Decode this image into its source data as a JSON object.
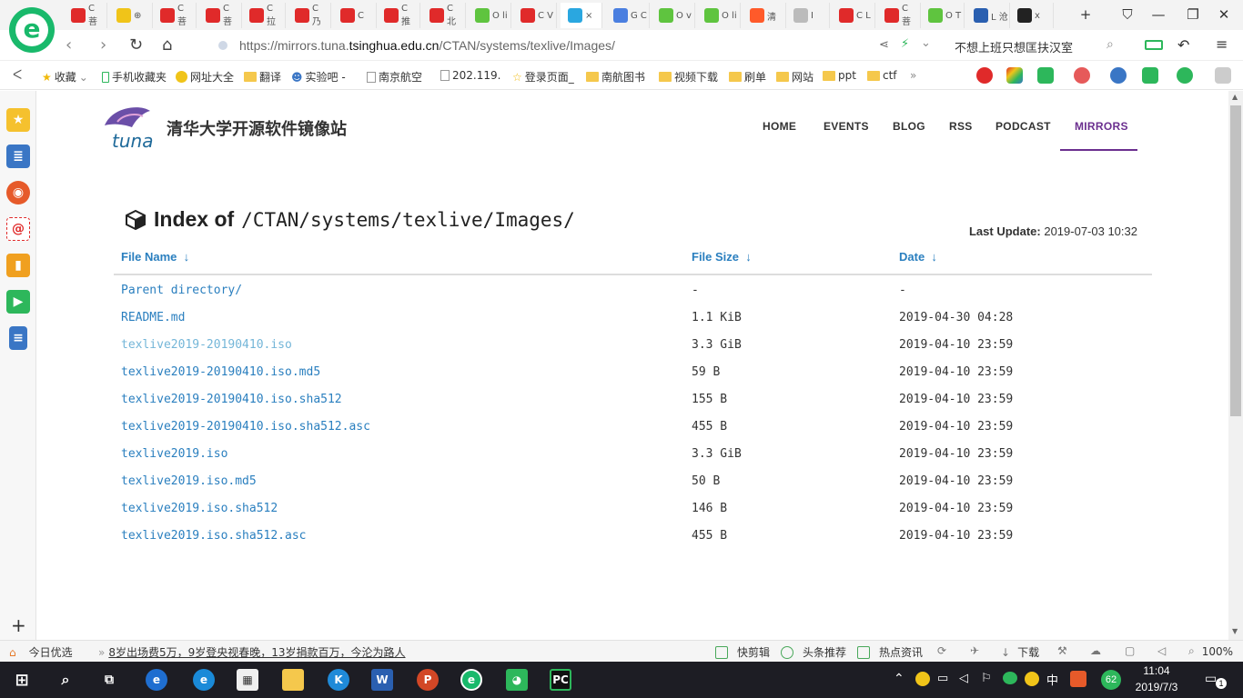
{
  "browser": {
    "tabs": [
      {
        "label": "C 菩",
        "color": "#e02a2a"
      },
      {
        "label": "⊕",
        "color": "#f0c419"
      },
      {
        "label": "C 菩",
        "color": "#e02a2a"
      },
      {
        "label": "C 菩",
        "color": "#e02a2a"
      },
      {
        "label": "C 拉",
        "color": "#e02a2a"
      },
      {
        "label": "C 乃",
        "color": "#e02a2a"
      },
      {
        "label": "C",
        "color": "#e02a2a"
      },
      {
        "label": "C 推",
        "color": "#e02a2a"
      },
      {
        "label": "C 北",
        "color": "#e02a2a"
      },
      {
        "label": "O li",
        "color": "#5fc43f"
      },
      {
        "label": "C V",
        "color": "#e02a2a"
      },
      {
        "label": "×",
        "color": "#2aa7e0"
      },
      {
        "label": "G C",
        "color": "#4a7fe0"
      },
      {
        "label": "O v",
        "color": "#5fc43f"
      },
      {
        "label": "O li",
        "color": "#5fc43f"
      },
      {
        "label": "清",
        "color": "#ff5a2a"
      },
      {
        "label": "I",
        "color": "#bbbbbb"
      },
      {
        "label": "C L",
        "color": "#e02a2a"
      },
      {
        "label": "C 菩",
        "color": "#e02a2a"
      },
      {
        "label": "O T",
        "color": "#5fc43f"
      },
      {
        "label": "L 沧",
        "color": "#2a5fb0"
      },
      {
        "label": "x",
        "color": "#222222"
      }
    ],
    "url_prefix": "https://mirrors.tuna.",
    "url_domain": "tsinghua.edu.cn",
    "url_path": "/CTAN/systems/texlive/Images/",
    "search_text": "不想上班只想匡扶汉室",
    "bookmarks": [
      {
        "label": "收藏"
      },
      {
        "label": "手机收藏夹"
      },
      {
        "label": "网址大全"
      },
      {
        "label": "翻译"
      },
      {
        "label": "实验吧 -"
      },
      {
        "label": "南京航空"
      },
      {
        "label": "202.119."
      },
      {
        "label": "登录页面_"
      },
      {
        "label": "南航图书"
      },
      {
        "label": "视频下载"
      },
      {
        "label": "刷单"
      },
      {
        "label": "网站"
      },
      {
        "label": "ppt"
      },
      {
        "label": "ctf"
      }
    ]
  },
  "site": {
    "brand": "清华大学开源软件镜像站",
    "nav": [
      "HOME",
      "EVENTS",
      "BLOG",
      "RSS",
      "PODCAST",
      "MIRRORS"
    ],
    "heading_prefix": "Index of",
    "heading_path": "/CTAN/systems/texlive/Images/",
    "last_update_label": "Last Update:",
    "last_update_value": "2019-07-03 10:32",
    "columns": {
      "name": "File Name",
      "size": "File Size",
      "date": "Date",
      "sort_arrow": "↓"
    },
    "rows": [
      {
        "name": "Parent directory/",
        "size": "-",
        "date": "-"
      },
      {
        "name": "README.md",
        "size": "1.1 KiB",
        "date": "2019-04-30 04:28"
      },
      {
        "name": "texlive2019-20190410.iso",
        "size": "3.3 GiB",
        "date": "2019-04-10 23:59",
        "visited": true
      },
      {
        "name": "texlive2019-20190410.iso.md5",
        "size": "59 B",
        "date": "2019-04-10 23:59"
      },
      {
        "name": "texlive2019-20190410.iso.sha512",
        "size": "155 B",
        "date": "2019-04-10 23:59"
      },
      {
        "name": "texlive2019-20190410.iso.sha512.asc",
        "size": "455 B",
        "date": "2019-04-10 23:59"
      },
      {
        "name": "texlive2019.iso",
        "size": "3.3 GiB",
        "date": "2019-04-10 23:59"
      },
      {
        "name": "texlive2019.iso.md5",
        "size": "50 B",
        "date": "2019-04-10 23:59"
      },
      {
        "name": "texlive2019.iso.sha512",
        "size": "146 B",
        "date": "2019-04-10 23:59"
      },
      {
        "name": "texlive2019.iso.sha512.asc",
        "size": "455 B",
        "date": "2019-04-10 23:59"
      }
    ],
    "accent_color": "#6b2f8f",
    "link_color": "#2a7fbf"
  },
  "statusbar": {
    "today": "今日优选",
    "news": "8岁出场费5万，9岁登央视春晚，13岁捐款百万，今沦为路人",
    "quick_edit": "快剪辑",
    "headline": "头条推荐",
    "hot_news": "热点资讯",
    "download": "下载",
    "zoom": "100%"
  },
  "taskbar": {
    "time": "11:04",
    "date": "2019/7/3",
    "ime": "中",
    "battery_badge": "62",
    "notification_count": "1"
  }
}
